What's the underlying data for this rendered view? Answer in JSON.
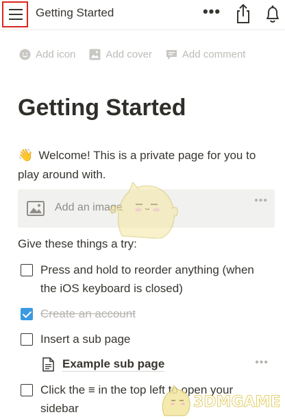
{
  "topbar": {
    "title": "Getting Started",
    "menu_icon": "hamburger-icon",
    "more_icon": "more-horizontal-icon",
    "share_icon": "share-icon",
    "bell_icon": "bell-icon",
    "highlight_color": "#d9261c"
  },
  "page_actions": [
    {
      "label": "Add icon",
      "icon": "smiley-icon"
    },
    {
      "label": "Add cover",
      "icon": "image-icon"
    },
    {
      "label": "Add comment",
      "icon": "comment-icon"
    }
  ],
  "page": {
    "heading": "Getting Started",
    "welcome_emoji": "👋",
    "welcome_text": "Welcome! This is a private page for you to play around with.",
    "image_block_label": "Add an image",
    "image_block_more": "•••",
    "subheading": "Give these things a try:"
  },
  "todos": [
    {
      "text": "Press and hold to reorder anything (when the iOS keyboard is closed)",
      "checked": false
    },
    {
      "text": "Create an account",
      "checked": true
    },
    {
      "text": "Insert a sub page",
      "checked": false
    },
    {
      "text": "Click the ≡ in the top left to open your sidebar",
      "checked": false
    }
  ],
  "subpage": {
    "label": "Example sub page",
    "icon": "document-icon",
    "more": "•••"
  },
  "watermark": {
    "text": "3DMGAME"
  },
  "colors": {
    "checkbox_checked": "#3a9ae0",
    "text": "#37352f",
    "muted": "#bdbbb6"
  }
}
